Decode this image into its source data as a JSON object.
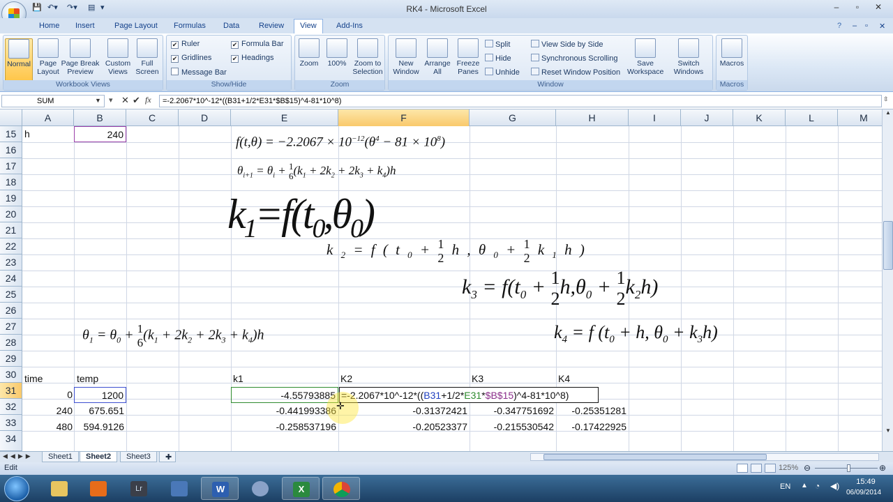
{
  "window": {
    "title": "RK4 - Microsoft Excel"
  },
  "ribbon": {
    "tabs": [
      "Home",
      "Insert",
      "Page Layout",
      "Formulas",
      "Data",
      "Review",
      "View",
      "Add-Ins"
    ],
    "active_tab": "View",
    "groups": {
      "workbook_views": {
        "label": "Workbook Views",
        "buttons": [
          "Normal",
          "Page Layout",
          "Page Break Preview",
          "Custom Views",
          "Full Screen"
        ]
      },
      "show_hide": {
        "label": "Show/Hide",
        "items": [
          {
            "label": "Ruler",
            "checked": true
          },
          {
            "label": "Gridlines",
            "checked": true
          },
          {
            "label": "Message Bar",
            "checked": false
          },
          {
            "label": "Formula Bar",
            "checked": true
          },
          {
            "label": "Headings",
            "checked": true
          }
        ]
      },
      "zoom": {
        "label": "Zoom",
        "buttons": [
          "Zoom",
          "100%",
          "Zoom to Selection"
        ]
      },
      "window": {
        "label": "Window",
        "buttons": [
          "New Window",
          "Arrange All",
          "Freeze Panes"
        ],
        "small": [
          "Split",
          "Hide",
          "Unhide",
          "View Side by Side",
          "Synchronous Scrolling",
          "Reset Window Position"
        ],
        "big2": [
          "Save Workspace",
          "Switch Windows"
        ]
      },
      "macros": {
        "label": "Macros",
        "buttons": [
          "Macros"
        ]
      }
    }
  },
  "formula_bar": {
    "name_box": "SUM",
    "formula": "=-2.2067*10^-12*((B31+1/2*E31*$B$15)^4-81*10^8)"
  },
  "columns": [
    "A",
    "B",
    "C",
    "D",
    "E",
    "F",
    "G",
    "H",
    "I",
    "J",
    "K",
    "L",
    "M"
  ],
  "rows": [
    "15",
    "16",
    "17",
    "18",
    "19",
    "20",
    "21",
    "22",
    "23",
    "24",
    "25",
    "26",
    "27",
    "28",
    "29",
    "30",
    "31",
    "32",
    "33",
    "34"
  ],
  "cells": {
    "A15": "h",
    "B15": "240",
    "A30": "time",
    "B30": "temp",
    "E30": "k1",
    "F30": "K2",
    "G30": "K3",
    "H30": "K4",
    "A31": "0",
    "B31": "1200",
    "E31": "-4.55793885",
    "A32": "240",
    "B32": "675.651",
    "E32": "-0.441993386",
    "F32": "-0.31372421",
    "G32": "-0.347751692",
    "H32": "-0.25351281",
    "A33": "480",
    "B33": "594.9126",
    "E33": "-0.258537196",
    "F33": "-0.20523377",
    "G33": "-0.215530542",
    "H33": "-0.17422925"
  },
  "edit_cell": {
    "parts": [
      {
        "text": "=-2.2067*10^-12*((",
        "color": "#111111"
      },
      {
        "text": "B31",
        "color": "#1f3fbf"
      },
      {
        "text": "+1/2*",
        "color": "#111111"
      },
      {
        "text": "E31",
        "color": "#2e8b2e"
      },
      {
        "text": "*",
        "color": "#111111"
      },
      {
        "text": "$B$15",
        "color": "#8b2f8b"
      },
      {
        "text": ")^4-81*10^8)",
        "color": "#111111"
      }
    ]
  },
  "sheets": [
    "Sheet1",
    "Sheet2",
    "Sheet3"
  ],
  "active_sheet": "Sheet2",
  "status": {
    "mode": "Edit",
    "zoom": "125%"
  },
  "taskbar": {
    "apps": [
      "Start",
      "File Explorer",
      "Media Player",
      "Lightroom",
      "Tool",
      "Word",
      "Clock",
      "Excel",
      "Chrome"
    ],
    "lang": "EN",
    "time": "15:49",
    "date": "06/09/2014"
  },
  "colors": {
    "accent": "#15428b",
    "selection": "#f9c96b",
    "ribbon": "#dbe7f5"
  }
}
